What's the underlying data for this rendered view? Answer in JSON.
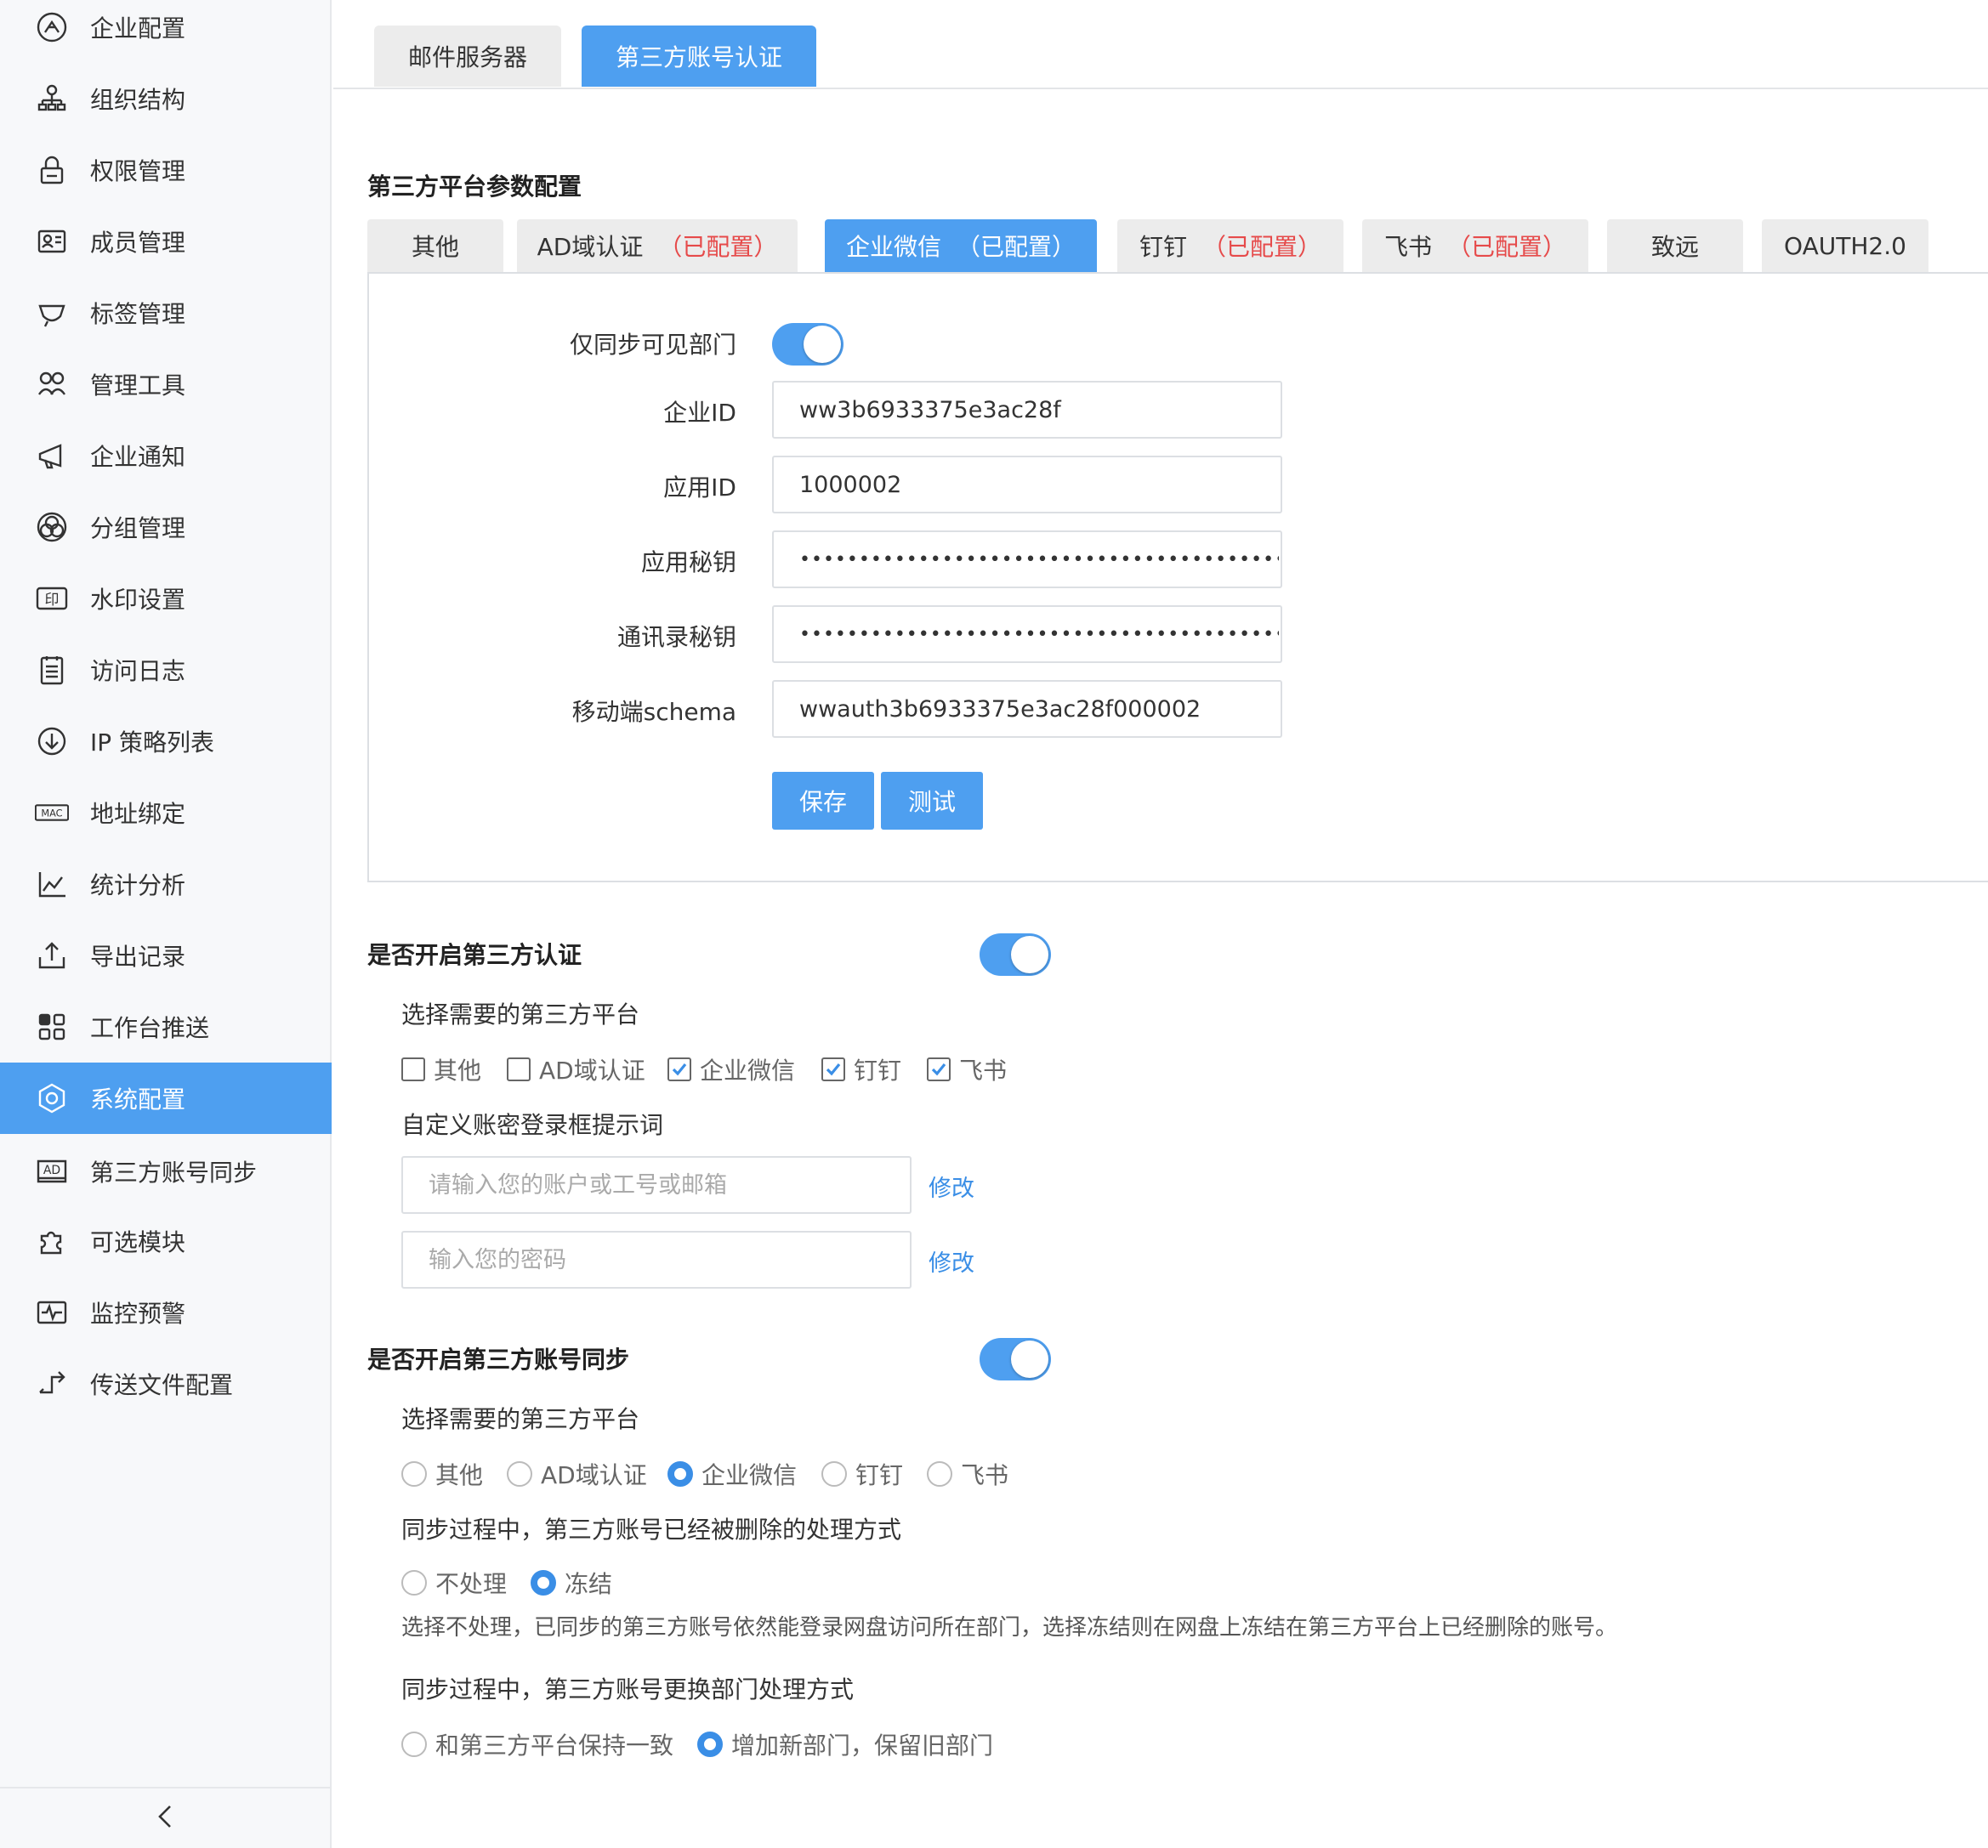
{
  "sidebar": {
    "items": [
      {
        "label": "企业配置",
        "icon": "enterprise-icon"
      },
      {
        "label": "组织结构",
        "icon": "org-structure-icon"
      },
      {
        "label": "权限管理",
        "icon": "lock-icon"
      },
      {
        "label": "成员管理",
        "icon": "id-card-icon"
      },
      {
        "label": "标签管理",
        "icon": "tag-icon"
      },
      {
        "label": "管理工具",
        "icon": "tools-icon"
      },
      {
        "label": "企业通知",
        "icon": "megaphone-icon"
      },
      {
        "label": "分组管理",
        "icon": "group-circles-icon"
      },
      {
        "label": "水印设置",
        "icon": "watermark-icon",
        "glyph": "印"
      },
      {
        "label": "访问日志",
        "icon": "log-list-icon"
      },
      {
        "label": "IP 策略列表",
        "icon": "download-circle-icon"
      },
      {
        "label": "地址绑定",
        "icon": "mac-icon",
        "glyph": "MAC"
      },
      {
        "label": "统计分析",
        "icon": "chart-icon"
      },
      {
        "label": "导出记录",
        "icon": "export-icon"
      },
      {
        "label": "工作台推送",
        "icon": "grid-icon"
      },
      {
        "label": "系统配置",
        "icon": "settings-hex-icon",
        "active": true
      },
      {
        "label": "第三方账号同步",
        "icon": "ad-icon",
        "glyph": "AD"
      },
      {
        "label": "可选模块",
        "icon": "puzzle-icon"
      },
      {
        "label": "监控预警",
        "icon": "monitor-icon"
      },
      {
        "label": "传送文件配置",
        "icon": "transfer-icon"
      }
    ],
    "collapse_icon": "chevron-left-icon"
  },
  "top_tabs": [
    {
      "label": "邮件服务器"
    },
    {
      "label": "第三方账号认证",
      "active": true
    }
  ],
  "platform_section": {
    "title": "第三方平台参数配置",
    "tabs": [
      {
        "label": "其他",
        "configured": ""
      },
      {
        "label": "AD域认证",
        "configured": "（已配置）"
      },
      {
        "label": "企业微信",
        "configured": "（已配置）",
        "active": true
      },
      {
        "label": "钉钉",
        "configured": "（已配置）"
      },
      {
        "label": "飞书",
        "configured": "（已配置）"
      },
      {
        "label": "致远",
        "configured": ""
      },
      {
        "label": "OAUTH2.0",
        "configured": ""
      }
    ],
    "form": {
      "sync_visible_label": "仅同步可见部门",
      "sync_visible_on": true,
      "corp_id_label": "企业ID",
      "corp_id_value": "ww3b6933375e3ac28f",
      "app_id_label": "应用ID",
      "app_id_value": "1000002",
      "app_secret_label": "应用秘钥",
      "app_secret_value": "••••••••••••••••••••••••••••••••••••••••••••",
      "contacts_secret_label": "通讯录秘钥",
      "contacts_secret_value": "••••••••••••••••••••••••••••••••••••••••••••",
      "schema_label": "移动端schema",
      "schema_value": "wwauth3b6933375e3ac28f000002",
      "save_label": "保存",
      "test_label": "测试"
    }
  },
  "auth_section": {
    "title": "是否开启第三方认证",
    "enabled": true,
    "platform_prompt": "选择需要的第三方平台",
    "platforms": [
      {
        "label": "其他",
        "checked": false
      },
      {
        "label": "AD域认证",
        "checked": false
      },
      {
        "label": "企业微信",
        "checked": true
      },
      {
        "label": "钉钉",
        "checked": true
      },
      {
        "label": "飞书",
        "checked": true
      }
    ],
    "custom_prompt_title": "自定义账密登录框提示词",
    "account_placeholder": "请输入您的账户或工号或邮箱",
    "password_placeholder": "输入您的密码",
    "edit_label": "修改"
  },
  "sync_section": {
    "title": "是否开启第三方账号同步",
    "enabled": true,
    "platform_prompt": "选择需要的第三方平台",
    "platforms": [
      {
        "label": "其他",
        "selected": false
      },
      {
        "label": "AD域认证",
        "selected": false
      },
      {
        "label": "企业微信",
        "selected": true
      },
      {
        "label": "钉钉",
        "selected": false
      },
      {
        "label": "飞书",
        "selected": false
      }
    ],
    "deleted_title": "同步过程中，第三方账号已经被删除的处理方式",
    "deleted_options": [
      {
        "label": "不处理",
        "selected": false
      },
      {
        "label": "冻结",
        "selected": true
      }
    ],
    "deleted_note": "选择不处理，已同步的第三方账号依然能登录网盘访问所在部门，选择冻结则在网盘上冻结在第三方平台上已经删除的账号。",
    "dept_title": "同步过程中，第三方账号更换部门处理方式",
    "dept_options": [
      {
        "label": "和第三方平台保持一致",
        "selected": false
      },
      {
        "label": "增加新部门，保留旧部门",
        "selected": true
      }
    ]
  },
  "colors": {
    "accent": "#4e9ff0",
    "configured_red": "#e64a4a",
    "link_blue": "#3a8ee6"
  }
}
